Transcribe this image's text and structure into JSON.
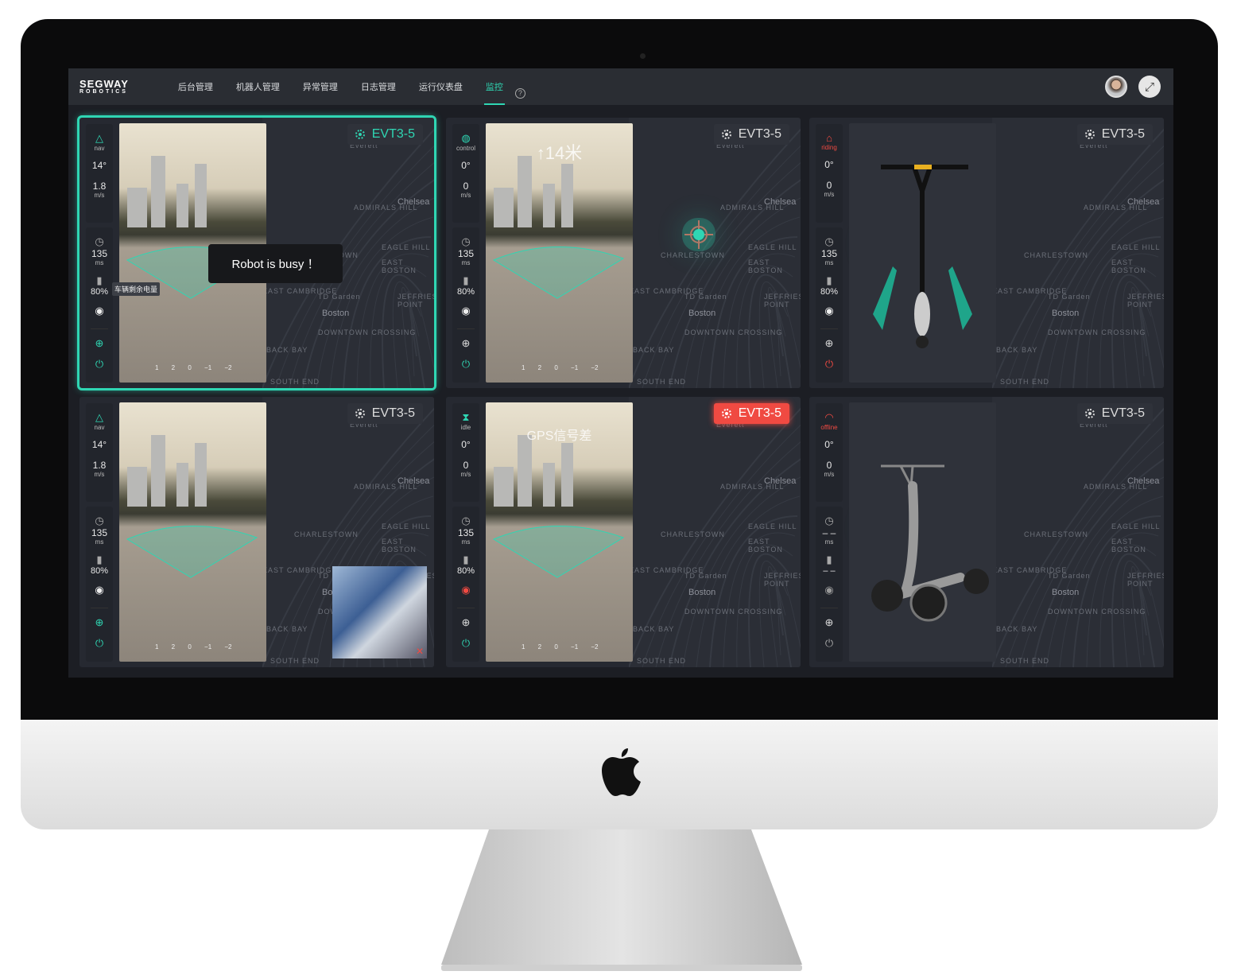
{
  "brand": {
    "line1": "SEGWAY",
    "line2": "ROBOTICS"
  },
  "nav": [
    {
      "label": "后台管理"
    },
    {
      "label": "机器人管理"
    },
    {
      "label": "异常管理"
    },
    {
      "label": "日志管理"
    },
    {
      "label": "运行仪表盘"
    },
    {
      "label": "监控",
      "active": true
    }
  ],
  "help_icon": "?",
  "expand_icon": "⤢",
  "accent": "#2fd6b3",
  "alert": "#f04a42",
  "map_labels": {
    "everett": "Everett",
    "chelsea": "Chelsea",
    "admirals": "ADMIRALS HILL",
    "charlestown": "CHARLESTOWN",
    "eagle": "EAGLE HILL",
    "eastboston": "EAST BOSTON",
    "eastcam": "EAST CAMBRIDGE",
    "tdgarden": "TD Garden",
    "jeffries": "JEFFRIES POINT",
    "boston": "Boston",
    "downtown": "DOWNTOWN CROSSING",
    "backbay": "BACK BAY",
    "southend": "SOUTH END"
  },
  "scale_ticks": "1 2 0 −1 −2",
  "panels": [
    {
      "name": "EVT3-5",
      "mode": "nav",
      "mode_icon": "navigation-arrow",
      "heading": "14°",
      "speed": "1.8",
      "speed_unit": "m/s",
      "latency": "135",
      "latency_unit": "ms",
      "battery": "80%",
      "selected": true,
      "tag_state": "green",
      "toast": "Robot is busy ！",
      "tooltip": "车辆剩余电量",
      "view": "camera",
      "gps_state": "ok",
      "power_state": "on"
    },
    {
      "name": "EVT3-5",
      "mode": "control",
      "mode_icon": "remote-control",
      "heading": "0°",
      "speed": "0",
      "speed_unit": "m/s",
      "latency": "135",
      "latency_unit": "ms",
      "battery": "80%",
      "tag_state": "normal",
      "overlay": "↑14米",
      "view": "camera",
      "target": true,
      "gps_state": "ok",
      "power_state": "on"
    },
    {
      "name": "EVT3-5",
      "mode": "riding",
      "mode_icon": "riding-warning",
      "mode_color": "#f04a42",
      "heading": "0°",
      "speed": "0",
      "speed_unit": "m/s",
      "latency": "135",
      "latency_unit": "ms",
      "battery": "80%",
      "tag_state": "normal",
      "view": "scooter-front",
      "gps_state": "ok",
      "power_state": "alert"
    },
    {
      "name": "EVT3-5",
      "mode": "nav",
      "mode_icon": "navigation-arrow",
      "heading": "14°",
      "speed": "1.8",
      "speed_unit": "m/s",
      "latency": "135",
      "latency_unit": "ms",
      "battery": "80%",
      "tag_state": "normal",
      "view": "camera",
      "pip": true,
      "gps_state": "ok",
      "power_state": "on"
    },
    {
      "name": "EVT3-5",
      "mode": "idle",
      "mode_icon": "hourglass",
      "heading": "0°",
      "speed": "0",
      "speed_unit": "m/s",
      "latency": "135",
      "latency_unit": "ms",
      "battery": "80%",
      "tag_state": "red",
      "overlay_small": "GPS信号差",
      "view": "camera",
      "gps_state": "bad",
      "power_state": "on"
    },
    {
      "name": "EVT3-5",
      "mode": "offline",
      "mode_icon": "wifi-offline",
      "mode_color": "#f04a42",
      "heading": "0°",
      "speed": "0",
      "speed_unit": "m/s",
      "latency": "– –",
      "latency_unit": "ms",
      "battery": "– –",
      "tag_state": "normal",
      "view": "scooter-side",
      "gps_state": "off",
      "power_state": "off"
    }
  ]
}
